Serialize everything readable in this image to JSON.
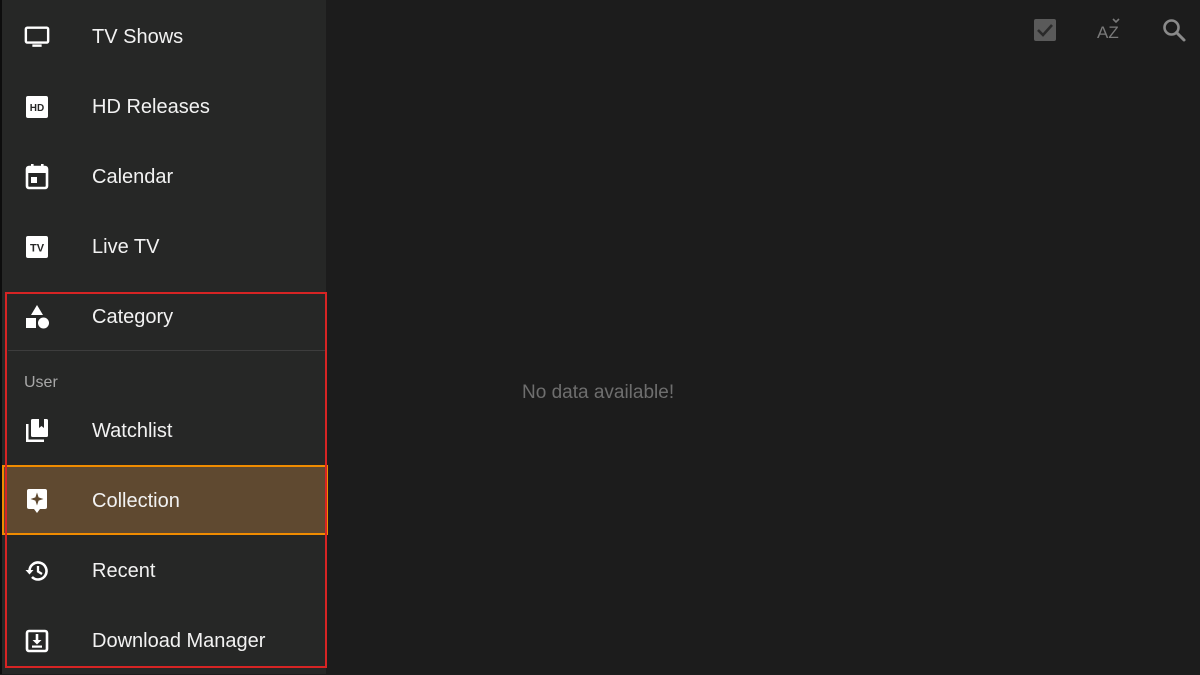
{
  "colors": {
    "drawer_bg": "#262726",
    "main_bg": "#1c1c1c",
    "active_item_bg": "#5f4930",
    "active_item_border": "#f08c00",
    "highlight_border": "#d62424",
    "text_primary": "#f2f2f2",
    "text_muted": "#6e6e6e"
  },
  "drawer": {
    "items_top": [
      {
        "label": "TV Shows",
        "icon": "tv-monitor-icon"
      },
      {
        "label": "HD Releases",
        "icon": "hd-icon"
      },
      {
        "label": "Calendar",
        "icon": "calendar-icon"
      },
      {
        "label": "Live TV",
        "icon": "live-tv-icon"
      },
      {
        "label": "Category",
        "icon": "category-shapes-icon"
      }
    ],
    "section_user": "User",
    "items_user": [
      {
        "label": "Watchlist",
        "icon": "watchlist-library-icon"
      },
      {
        "label": "Collection",
        "icon": "collection-star-icon",
        "active": true
      },
      {
        "label": "Recent",
        "icon": "history-icon"
      },
      {
        "label": "Download Manager",
        "icon": "download-icon"
      }
    ]
  },
  "topbar": {
    "icons": [
      "select-all-check-icon",
      "sort-az-icon",
      "search-icon"
    ],
    "sort_text": "AZ"
  },
  "main": {
    "empty_message": "No data available!"
  }
}
